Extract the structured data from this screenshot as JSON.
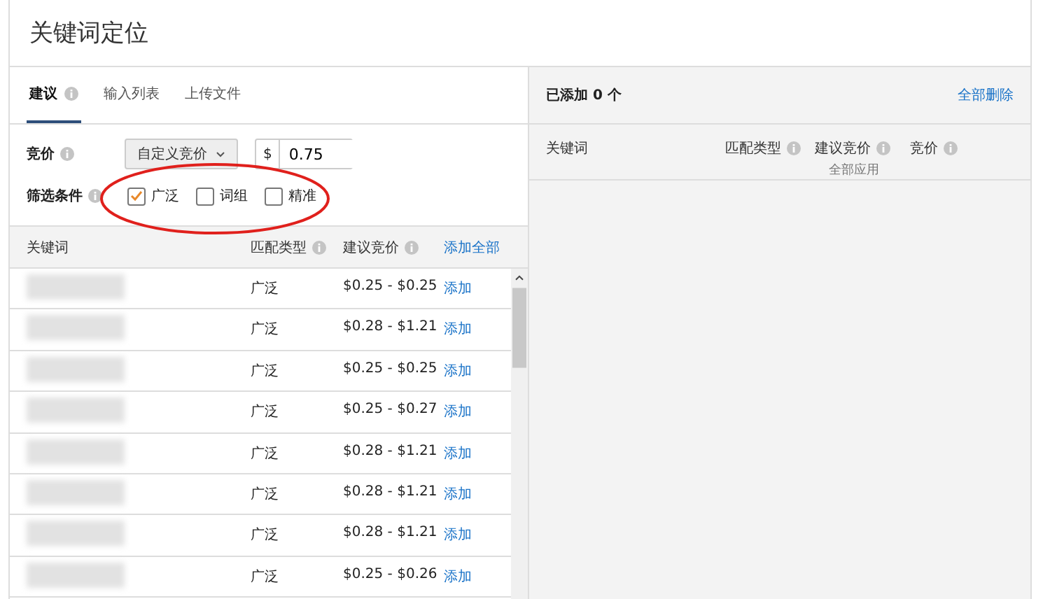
{
  "title": "关键词定位",
  "tabs": [
    {
      "label": "建议",
      "selected": true,
      "info": true
    },
    {
      "label": "输入列表",
      "selected": false,
      "info": false
    },
    {
      "label": "上传文件",
      "selected": false,
      "info": false
    }
  ],
  "bid": {
    "label": "竞价",
    "dropdown": "自定义竞价",
    "currency": "$",
    "value": "0.75"
  },
  "filter": {
    "label": "筛选条件",
    "options": [
      {
        "label": "广泛",
        "checked": true
      },
      {
        "label": "词组",
        "checked": false
      },
      {
        "label": "精准",
        "checked": false
      }
    ]
  },
  "table": {
    "columns": [
      "关键词",
      "匹配类型",
      "建议竞价"
    ],
    "add_all": "添加全部",
    "rows": [
      {
        "match": "广泛",
        "range": "$0.25 - $0.25",
        "action": "添加"
      },
      {
        "match": "广泛",
        "range": "$0.28 - $1.21",
        "action": "添加"
      },
      {
        "match": "广泛",
        "range": "$0.25 - $0.25",
        "action": "添加"
      },
      {
        "match": "广泛",
        "range": "$0.25 - $0.27",
        "action": "添加"
      },
      {
        "match": "广泛",
        "range": "$0.28 - $1.21",
        "action": "添加"
      },
      {
        "match": "广泛",
        "range": "$0.28 - $1.21",
        "action": "添加"
      },
      {
        "match": "广泛",
        "range": "$0.28 - $1.21",
        "action": "添加"
      },
      {
        "match": "广泛",
        "range": "$0.25 - $0.26",
        "action": "添加"
      }
    ]
  },
  "added": {
    "title": "已添加 0 个",
    "delete_all": "全部删除",
    "columns": [
      "关键词",
      "匹配类型",
      "建议竞价",
      "竞价"
    ],
    "apply_all": "全部应用"
  }
}
